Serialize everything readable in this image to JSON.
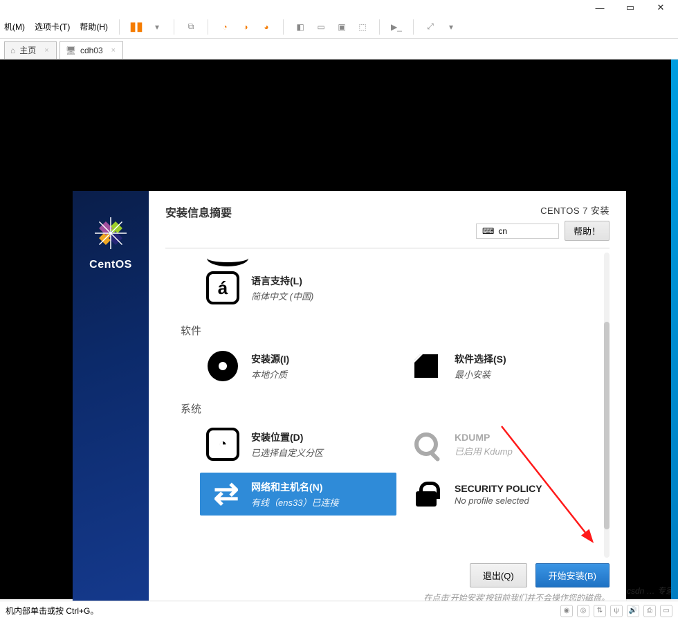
{
  "host": {
    "menus": {
      "m1": "机(M)",
      "m2": "选项卡(T)",
      "m3": "帮助(H)"
    },
    "tabs": {
      "home": "主页",
      "vm": "cdh03"
    },
    "status": "机内部单击或按 Ctrl+G。"
  },
  "installer": {
    "brand": "CentOS",
    "title": "安装信息摘要",
    "top_right": "CENTOS 7 安装",
    "keyboard": "cn",
    "help": "帮助！",
    "categories": {
      "software": "软件",
      "system": "系统"
    },
    "items": {
      "lang": {
        "title": "语言支持(L)",
        "sub": "简体中文 (中国)"
      },
      "source": {
        "title": "安装源(I)",
        "sub": "本地介质"
      },
      "soft": {
        "title": "软件选择(S)",
        "sub": "最小安装"
      },
      "dest": {
        "title": "安装位置(D)",
        "sub": "已选择自定义分区"
      },
      "kdump": {
        "title": "KDUMP",
        "sub": "已启用 Kdump"
      },
      "net": {
        "title": "网络和主机名(N)",
        "sub": "有线（ens33）已连接"
      },
      "sec": {
        "title": "SECURITY POLICY",
        "sub": "No profile selected"
      }
    },
    "buttons": {
      "quit": "退出(Q)",
      "begin": "开始安装(B)"
    },
    "disclaimer": "在点击'开始安装'按钮前我们并不会操作您的磁盘。"
  }
}
